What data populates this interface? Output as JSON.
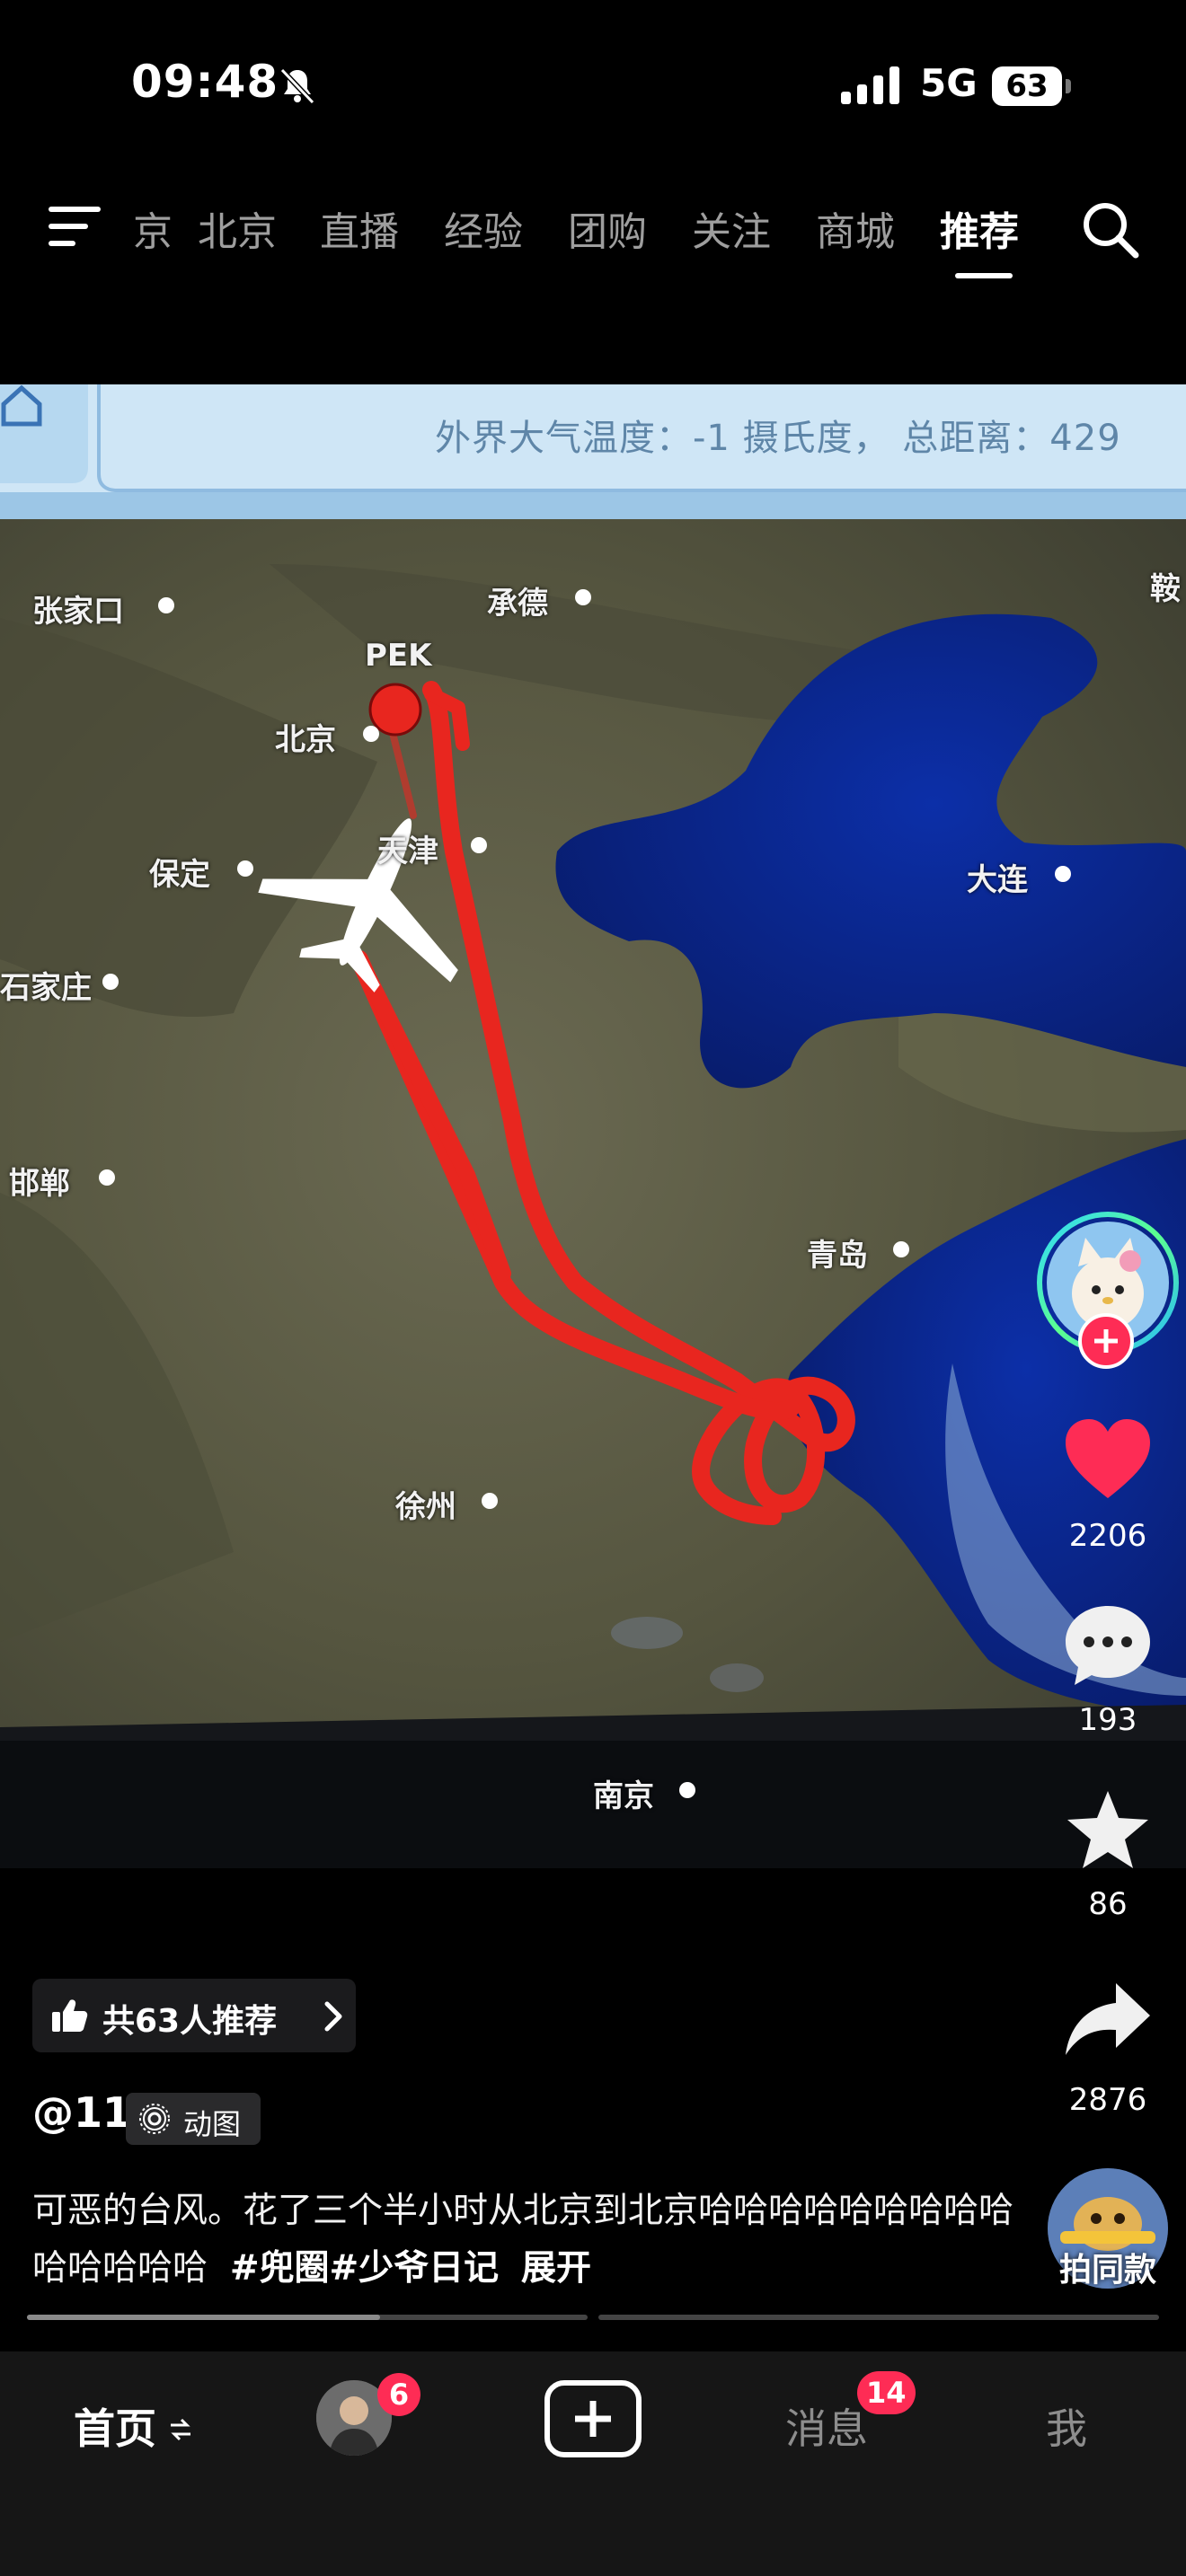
{
  "status_bar": {
    "time": "09:48",
    "network": "5G",
    "battery": "63"
  },
  "top_nav": {
    "tabs": [
      {
        "label": "京",
        "active": false
      },
      {
        "label": "北京",
        "active": false
      },
      {
        "label": "直播",
        "active": false
      },
      {
        "label": "经验",
        "active": false
      },
      {
        "label": "团购",
        "active": false
      },
      {
        "label": "关注",
        "active": false
      },
      {
        "label": "商城",
        "active": false
      },
      {
        "label": "推荐",
        "active": true
      }
    ]
  },
  "video": {
    "banner_text": "外界大气温度：-1 摄氏度，  总距离：429",
    "map_labels": {
      "zhangjiakou": "张家口",
      "chengde": "承德",
      "anshan": "鞍",
      "pek": "PEK",
      "beijing": "北京",
      "tianjin": "天津",
      "baoding": "保定",
      "shijiazhuang": "石家庄",
      "dalian": "大连",
      "handan": "邯郸",
      "qingdao": "青岛",
      "xuzhou": "徐州",
      "nanjing": "南京"
    }
  },
  "actions": {
    "likes": "2206",
    "comments": "193",
    "favorites": "86",
    "shares": "2876"
  },
  "info": {
    "recommend_chip": "共63人推荐",
    "author": "@11",
    "motion_tag": "动图",
    "caption_text": "可恶的台风。花了三个半小时从北京到北京哈哈哈哈哈哈哈哈哈哈哈哈哈哈",
    "hashtag_1": "#兜圈",
    "hashtag_2": "#少爷日记",
    "expand": "展开",
    "same_style": "拍同款"
  },
  "playback": {
    "segments": 2,
    "current_segment_progress": 0.63
  },
  "bottom_tabs": {
    "home": "首页",
    "friend_badge": "6",
    "messages": "消息",
    "messages_badge": "14",
    "me": "我"
  },
  "colors": {
    "accent": "#fe2c55",
    "route": "#e8261f",
    "sea": "#0a2a8c",
    "banner": "#cfe6f6"
  }
}
